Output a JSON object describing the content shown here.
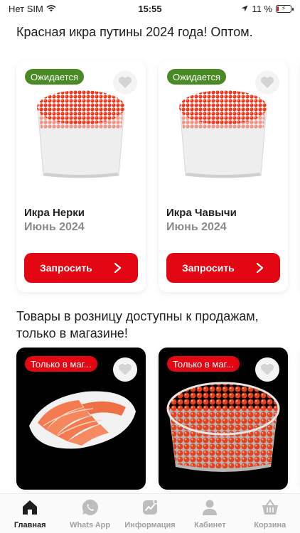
{
  "status": {
    "carrier": "Нет SIM",
    "time": "15:55",
    "battery": "11 %",
    "battery_level": 0.11
  },
  "sections": [
    {
      "title": "Красная икра путины 2024 года! Оптом.",
      "products": [
        {
          "badge": "Ожидается",
          "name": "Икра Нерки",
          "subtitle": "Июнь 2024",
          "button": "Запросить"
        },
        {
          "badge": "Ожидается",
          "name": "Икра Чавычи",
          "subtitle": "Июнь 2024",
          "button": "Запросить"
        }
      ]
    },
    {
      "title": "Товары в розницу доступны к продажам, только в магазине!",
      "products": [
        {
          "badge": "Только в маг..."
        },
        {
          "badge": "Только в маг..."
        }
      ]
    }
  ],
  "tabbar": [
    {
      "label": "Главная",
      "icon": "home-icon",
      "active": true
    },
    {
      "label": "Whats App",
      "icon": "whatsapp-icon",
      "active": false
    },
    {
      "label": "Информация",
      "icon": "info-chart-icon",
      "active": false
    },
    {
      "label": "Кабинет",
      "icon": "user-icon",
      "active": false
    },
    {
      "label": "Корзина",
      "icon": "basket-icon",
      "active": false
    }
  ],
  "colors": {
    "accent": "#e30613",
    "badge_expected": "#4a8a24",
    "muted_text": "#8a8a8a"
  }
}
